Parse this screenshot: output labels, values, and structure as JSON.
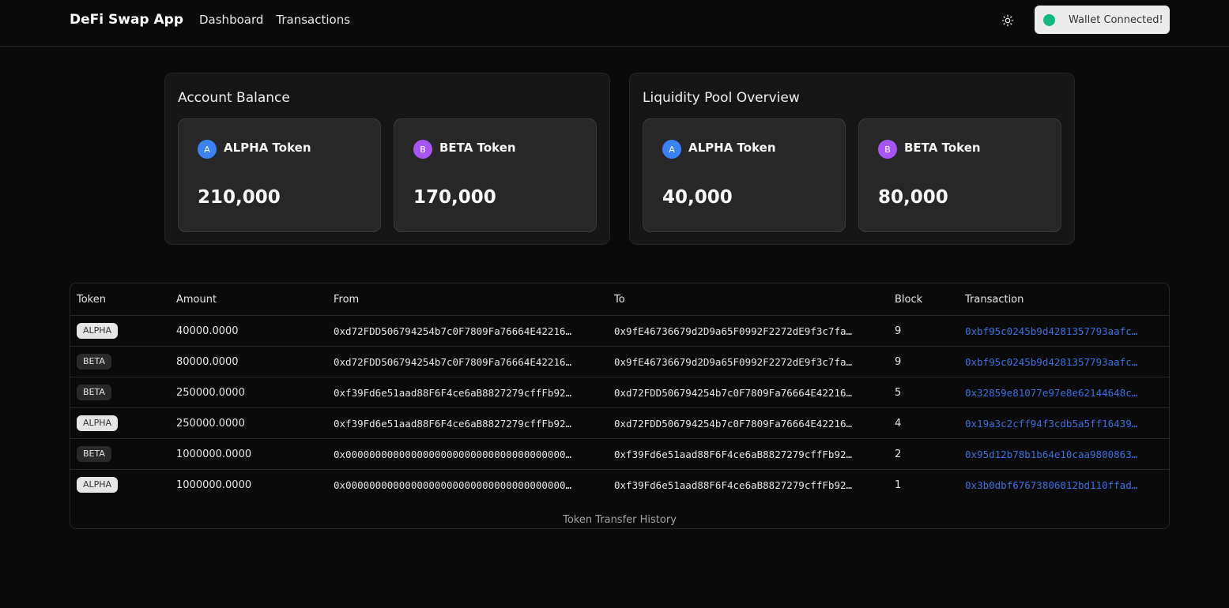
{
  "app": {
    "title": "DeFi Swap App"
  },
  "nav": {
    "items": [
      "Dashboard",
      "Transactions"
    ]
  },
  "wallet": {
    "status": "Wallet Connected!",
    "status_color": "#10b981"
  },
  "account_balance": {
    "title": "Account Balance",
    "tokens": [
      {
        "badge": "A",
        "name": "ALPHA Token",
        "value": "210,000",
        "color": "#3b82f6"
      },
      {
        "badge": "B",
        "name": "BETA Token",
        "value": "170,000",
        "color": "#a855f7"
      }
    ]
  },
  "liquidity_pool": {
    "title": "Liquidity Pool Overview",
    "tokens": [
      {
        "badge": "A",
        "name": "ALPHA Token",
        "value": "40,000",
        "color": "#3b82f6"
      },
      {
        "badge": "B",
        "name": "BETA Token",
        "value": "80,000",
        "color": "#a855f7"
      }
    ]
  },
  "transfers": {
    "columns": [
      "Token",
      "Amount",
      "From",
      "To",
      "Block",
      "Transaction"
    ],
    "caption": "Token Transfer History",
    "rows": [
      {
        "token": "ALPHA",
        "amount": "40000.0000",
        "from": "0xd72FDD506794254b7c0F7809Fa76664E42216…",
        "to": "0x9fE46736679d2D9a65F0992F2272dE9f3c7fa…",
        "block": "9",
        "tx": "0xbf95c0245b9d4281357793aafc…"
      },
      {
        "token": "BETA",
        "amount": "80000.0000",
        "from": "0xd72FDD506794254b7c0F7809Fa76664E42216…",
        "to": "0x9fE46736679d2D9a65F0992F2272dE9f3c7fa…",
        "block": "9",
        "tx": "0xbf95c0245b9d4281357793aafc…"
      },
      {
        "token": "BETA",
        "amount": "250000.0000",
        "from": "0xf39Fd6e51aad88F6F4ce6aB8827279cffFb92…",
        "to": "0xd72FDD506794254b7c0F7809Fa76664E42216…",
        "block": "5",
        "tx": "0x32859e81077e97e8e62144648c…"
      },
      {
        "token": "ALPHA",
        "amount": "250000.0000",
        "from": "0xf39Fd6e51aad88F6F4ce6aB8827279cffFb92…",
        "to": "0xd72FDD506794254b7c0F7809Fa76664E42216…",
        "block": "4",
        "tx": "0x19a3c2cff94f3cdb5a5ff16439…"
      },
      {
        "token": "BETA",
        "amount": "1000000.0000",
        "from": "0x0000000000000000000000000000000000000…",
        "to": "0xf39Fd6e51aad88F6F4ce6aB8827279cffFb92…",
        "block": "2",
        "tx": "0x95d12b78b1b64e10caa9800863…"
      },
      {
        "token": "ALPHA",
        "amount": "1000000.0000",
        "from": "0x0000000000000000000000000000000000000…",
        "to": "0xf39Fd6e51aad88F6F4ce6aB8827279cffFb92…",
        "block": "1",
        "tx": "0x3b0dbf67673806012bd110ffad…"
      }
    ]
  }
}
